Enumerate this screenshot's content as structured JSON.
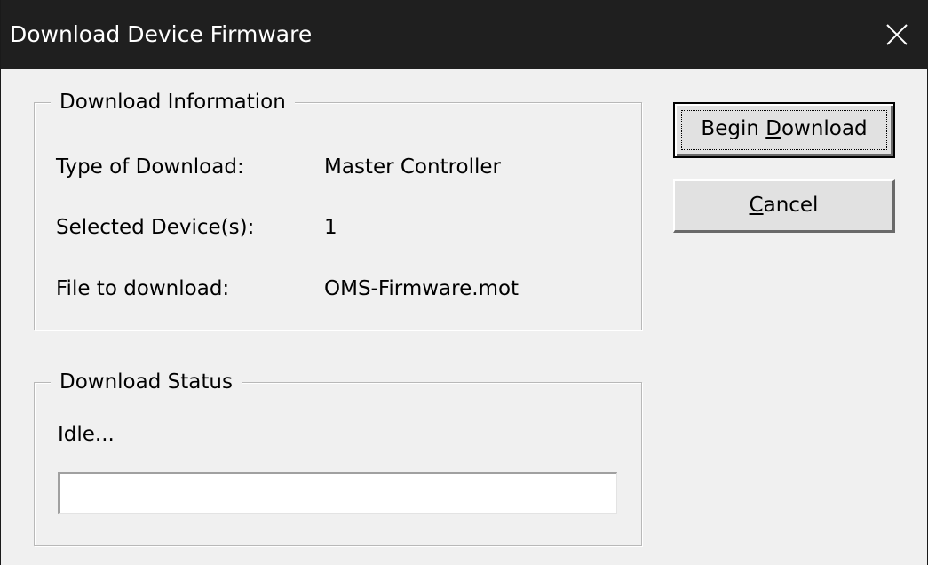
{
  "window": {
    "title": "Download Device Firmware"
  },
  "info_group": {
    "legend": "Download Information",
    "rows": [
      {
        "label": "Type of Download:",
        "value": "Master Controller"
      },
      {
        "label": "Selected Device(s):",
        "value": "1"
      },
      {
        "label": "File to download:",
        "value": "OMS-Firmware.mot"
      }
    ]
  },
  "status_group": {
    "legend": "Download Status",
    "status_text": "Idle...",
    "progress": 0
  },
  "buttons": {
    "begin_download": {
      "before": "Begin ",
      "mnemonic": "D",
      "after": "ownload"
    },
    "cancel": {
      "before": "",
      "mnemonic": "C",
      "after": "ancel"
    }
  },
  "icons": {
    "close": "close-icon"
  }
}
